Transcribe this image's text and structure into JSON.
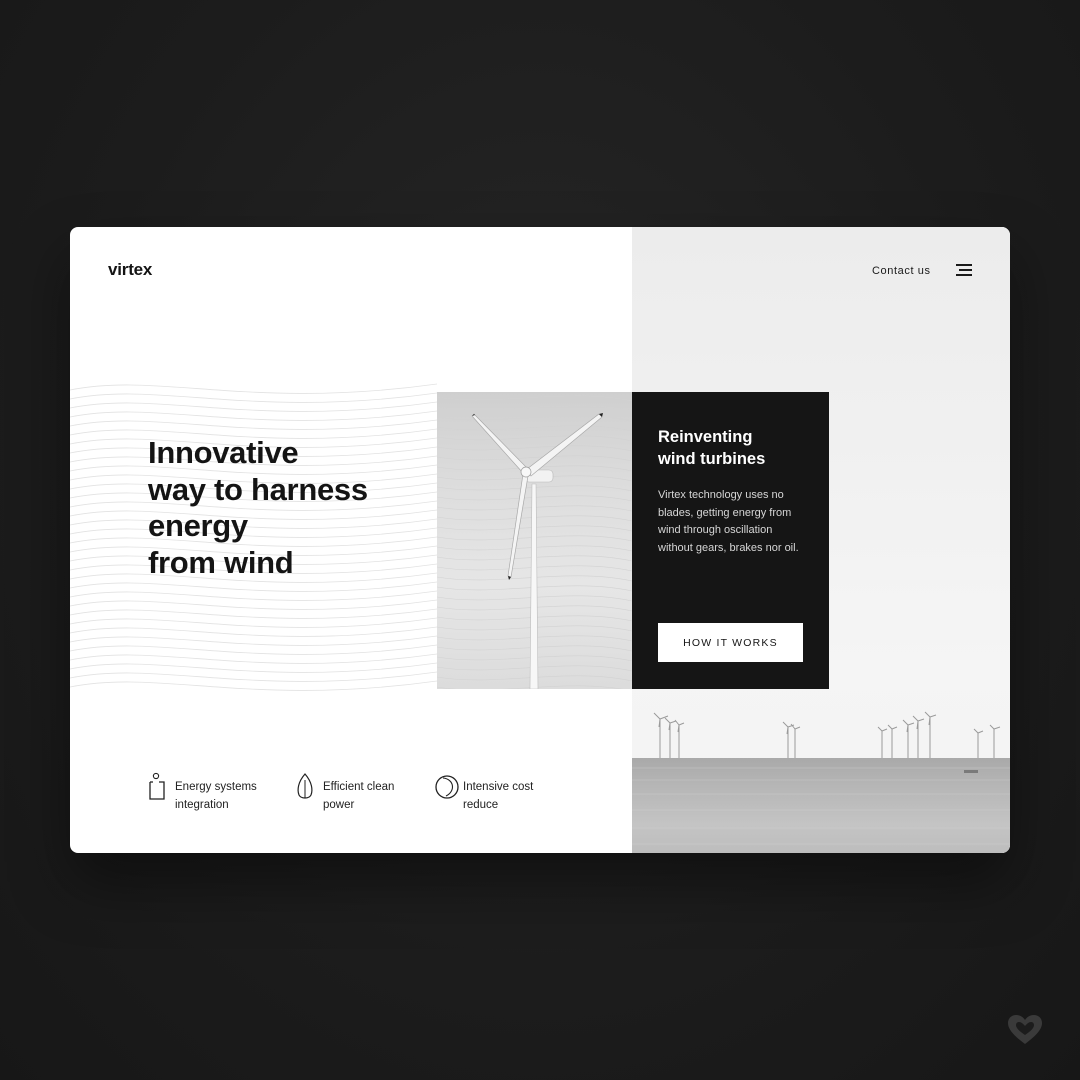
{
  "brand": {
    "logo_text": "virtex"
  },
  "header": {
    "contact_label": "Contact us"
  },
  "hero": {
    "headline_lines": [
      "Innovative",
      "way to harness",
      "energy",
      "from wind"
    ]
  },
  "panel": {
    "title_lines": [
      "Reinventing",
      "wind turbines"
    ],
    "body": "Virtex technology uses no blades, getting energy from wind through oscillation without gears, brakes nor oil.",
    "button_label": "HOW IT WORKS"
  },
  "features": [
    {
      "icon": "energy-systems-icon",
      "line1": "Energy systems",
      "line2": "integration"
    },
    {
      "icon": "leaf-icon",
      "line1": "Efficient clean",
      "line2": "power"
    },
    {
      "icon": "moon-cost-icon",
      "line1": "Intensive cost",
      "line2": "reduce"
    }
  ],
  "colors": {
    "page_bg": "#1c1c1c",
    "card_bg": "#ffffff",
    "dark_panel": "#151515",
    "text": "#141414"
  },
  "icons": {
    "menu": "hamburger-menu-icon",
    "watermark": "heart-icon"
  }
}
